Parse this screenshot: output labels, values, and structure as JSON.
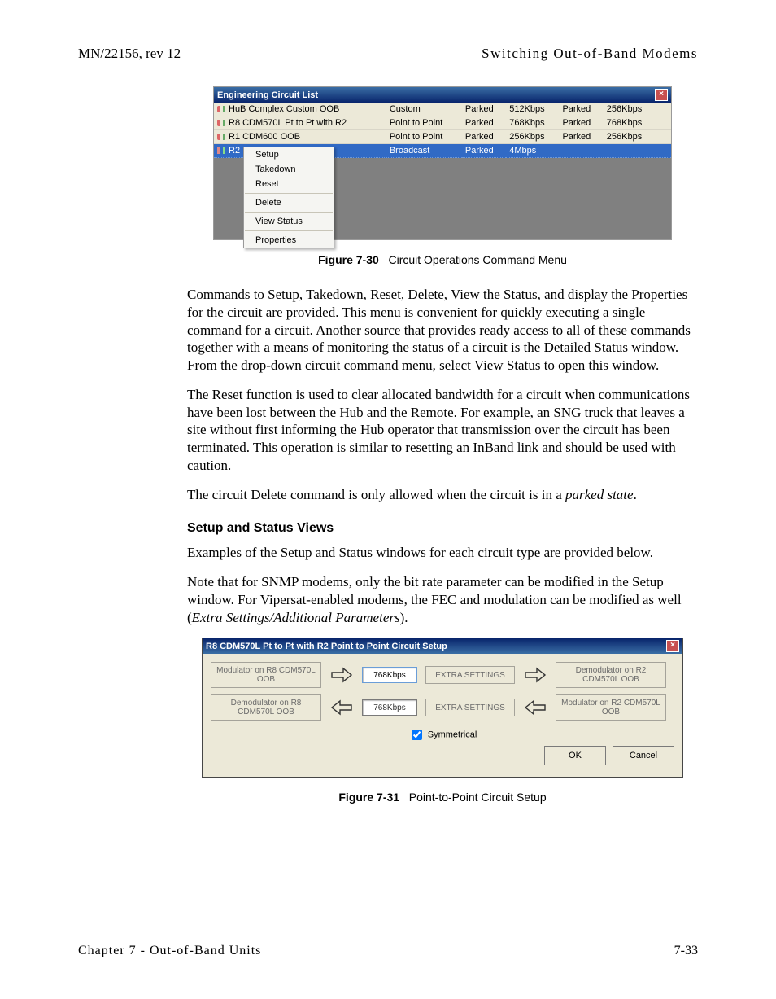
{
  "header": {
    "left": "MN/22156, rev 12",
    "right": "Switching Out-of-Band Modems"
  },
  "footer": {
    "left": "Chapter 7 - Out-of-Band Units",
    "right": "7-33"
  },
  "fig1": {
    "title": "Engineering Circuit List",
    "rows": [
      {
        "name": "HuB Complex Custom OOB",
        "type": "Custom",
        "s1": "Parked",
        "r1": "512Kbps",
        "s2": "Parked",
        "r2": "256Kbps"
      },
      {
        "name": "R8 CDM570L Pt to Pt with R2",
        "type": "Point to Point",
        "s1": "Parked",
        "r1": "768Kbps",
        "s2": "Parked",
        "r2": "768Kbps"
      },
      {
        "name": "R1 CDM600 OOB",
        "type": "Point to Point",
        "s1": "Parked",
        "r1": "256Kbps",
        "s2": "Parked",
        "r2": "256Kbps"
      },
      {
        "name": "R2 Brd",
        "type": "Broadcast",
        "s1": "Parked",
        "r1": "4Mbps",
        "s2": "",
        "r2": ""
      }
    ],
    "menu": [
      "Setup",
      "Takedown",
      "Reset",
      "Delete",
      "View Status",
      "Properties"
    ]
  },
  "caption1": {
    "label": "Figure 7-30",
    "text": "Circuit Operations Command Menu"
  },
  "paras": {
    "p1": "Commands to Setup, Takedown, Reset, Delete, View the Status, and display the Properties for the circuit are provided. This menu is convenient for quickly executing a single command for a circuit. Another source that provides ready access to all of these commands together with a means of monitoring the status of a circuit is the Detailed Status window. From the drop-down circuit command menu, select View Status to open this window.",
    "p2": "The Reset function is used to clear allocated bandwidth for a circuit when communications have been lost between the Hub and the Remote.  For example, an SNG truck that leaves a site without first informing the Hub operator that transmission over the circuit has been terminated. This operation is similar to resetting an InBand link and should be used with caution.",
    "p3a": "The circuit Delete command is only allowed when the circuit is in a ",
    "p3b": "parked state",
    "p3c": ".",
    "head": "Setup and Status Views",
    "p4": "Examples of the Setup and Status windows for each circuit type are provided below.",
    "p5a": "Note that for SNMP modems, only the bit rate parameter can be modified in the Setup window. For Vipersat-enabled modems, the FEC and modulation can be modified as well (",
    "p5b": "Extra Settings/Additional Parameters",
    "p5c": ")."
  },
  "fig2": {
    "title": "R8 CDM570L Pt to Pt with R2 Point to Point Circuit Setup",
    "row1": {
      "left": "Modulator on R8 CDM570L OOB",
      "rate": "768Kbps",
      "btn": "EXTRA SETTINGS",
      "right": "Demodulator on R2 CDM570L OOB"
    },
    "row2": {
      "left": "Demodulator on R8 CDM570L OOB",
      "rate": "768Kbps",
      "btn": "EXTRA SETTINGS",
      "right": "Modulator on R2 CDM570L OOB"
    },
    "sym": "Symmetrical",
    "ok": "OK",
    "cancel": "Cancel"
  },
  "caption2": {
    "label": "Figure 7-31",
    "text": "Point-to-Point Circuit Setup"
  }
}
